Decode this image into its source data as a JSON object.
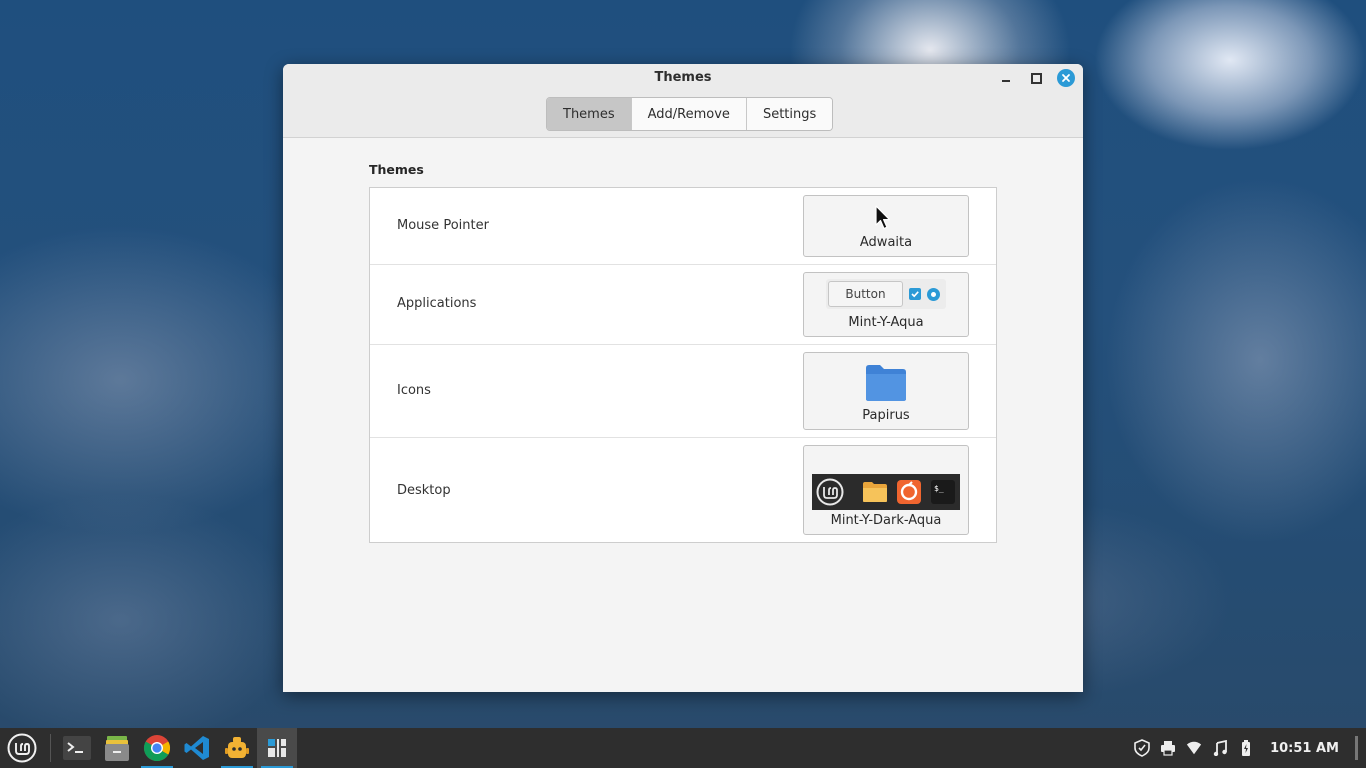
{
  "window": {
    "title": "Themes",
    "tabs": [
      {
        "label": "Themes",
        "active": true
      },
      {
        "label": "Add/Remove",
        "active": false
      },
      {
        "label": "Settings",
        "active": false
      }
    ]
  },
  "themes": {
    "section_title": "Themes",
    "rows": [
      {
        "label": "Mouse Pointer",
        "value": "Adwaita"
      },
      {
        "label": "Applications",
        "value": "Mint-Y-Aqua",
        "preview_button": "Button"
      },
      {
        "label": "Icons",
        "value": "Papirus"
      },
      {
        "label": "Desktop",
        "value": "Mint-Y-Dark-Aqua"
      }
    ]
  },
  "taskbar": {
    "apps": [
      "menu-icon",
      "terminal-icon",
      "file-manager-icon",
      "chrome-icon",
      "vscode-icon",
      "app-icon",
      "themes-app-icon"
    ],
    "clock": "10:51 AM"
  },
  "colors": {
    "accent": "#2b9ad6",
    "window_bg": "#f4f4f4",
    "taskbar_bg": "#2e2e2e"
  }
}
